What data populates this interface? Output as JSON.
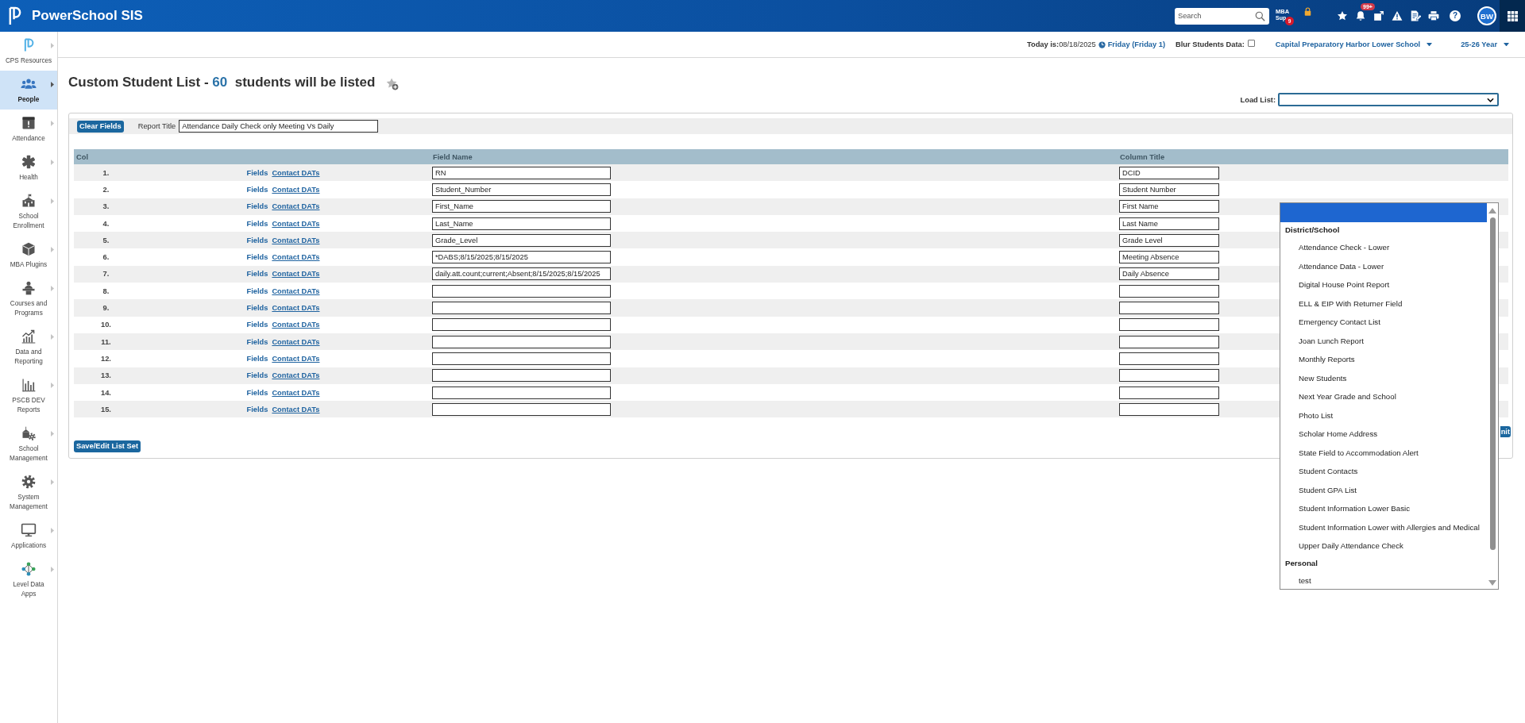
{
  "topbar": {
    "app_name": "PowerSchool SIS",
    "search": {
      "placeholder": "Search"
    },
    "mba": {
      "top": "MBA",
      "bottom": "Sup",
      "badge": "9"
    },
    "bell_badge": "99+",
    "help": "?",
    "avatar": "BW"
  },
  "sidebar": {
    "items": [
      {
        "label": "CPS Resources",
        "selected": false
      },
      {
        "label": "People",
        "selected": true
      },
      {
        "label": "Attendance",
        "selected": false
      },
      {
        "label": "Health",
        "selected": false
      },
      {
        "label": "School Enrollment",
        "selected": false
      },
      {
        "label": "MBA Plugins",
        "selected": false
      },
      {
        "label": "Courses and Programs",
        "selected": false
      },
      {
        "label": "Data and Reporting",
        "selected": false
      },
      {
        "label": "PSCB DEV Reports",
        "selected": false
      },
      {
        "label": "School Management",
        "selected": false
      },
      {
        "label": "System Management",
        "selected": false
      },
      {
        "label": "Applications",
        "selected": false
      },
      {
        "label": "Level Data Apps",
        "selected": false
      }
    ]
  },
  "header": {
    "today_label": "Today is:",
    "date": "08/18/2025",
    "day": "Friday (Friday 1)",
    "blur_label": "Blur Students Data:",
    "blur_checked": false,
    "school": "Capital Preparatory Harbor Lower School",
    "year": "25-26 Year"
  },
  "page": {
    "title": "Custom Student List - ",
    "count": "60",
    "title_end": "students will be listed"
  },
  "load_list": {
    "label": "Load List:",
    "open": true,
    "blank_option_selected": true,
    "groups": [
      {
        "label": "District/School",
        "options": [
          {
            "label": "Attendance Check - Lower",
            "selected": false
          },
          {
            "label": "Attendance Data - Lower",
            "selected": false
          },
          {
            "label": "Digital House Point Report",
            "selected": false
          },
          {
            "label": "ELL & EIP With Returner Field",
            "selected": false
          },
          {
            "label": "Emergency Contact List",
            "selected": false
          },
          {
            "label": "Joan Lunch Report",
            "selected": false
          },
          {
            "label": "Monthly Reports",
            "selected": false
          },
          {
            "label": "New Students",
            "selected": false
          },
          {
            "label": "Next Year Grade and School",
            "selected": false
          },
          {
            "label": "Photo List",
            "selected": false
          },
          {
            "label": "Scholar Home Address",
            "selected": false
          },
          {
            "label": "State Field to Accommodation Alert",
            "selected": false
          },
          {
            "label": "Student Contacts",
            "selected": false
          },
          {
            "label": "Student GPA List",
            "selected": false
          },
          {
            "label": "Student Information Lower Basic",
            "selected": false
          },
          {
            "label": "Student Information Lower with Allergies and Medical",
            "selected": false
          },
          {
            "label": "Upper Daily Attendance Check",
            "selected": false
          }
        ]
      },
      {
        "label": "Personal",
        "options": [
          {
            "label": "test",
            "selected": false
          }
        ]
      }
    ]
  },
  "form": {
    "clear_button": "Clear Fields",
    "report_title_label": "Report Title",
    "report_title": "Attendance Daily Check only Meeting Vs Daily",
    "columns": {
      "col": "Col",
      "field_name": "Field Name",
      "column_title": "Column Title"
    },
    "rows": [
      {
        "number": "1.",
        "fields_link": "Fields",
        "dats_link": "Contact DATs",
        "field_name": "RN",
        "column_title": "DCID"
      },
      {
        "number": "2.",
        "fields_link": "Fields",
        "dats_link": "Contact DATs",
        "field_name": "Student_Number",
        "column_title": "Student Number"
      },
      {
        "number": "3.",
        "fields_link": "Fields",
        "dats_link": "Contact DATs",
        "field_name": "First_Name",
        "column_title": "First Name"
      },
      {
        "number": "4.",
        "fields_link": "Fields",
        "dats_link": "Contact DATs",
        "field_name": "Last_Name",
        "column_title": "Last Name"
      },
      {
        "number": "5.",
        "fields_link": "Fields",
        "dats_link": "Contact DATs",
        "field_name": "Grade_Level",
        "column_title": "Grade Level"
      },
      {
        "number": "6.",
        "fields_link": "Fields",
        "dats_link": "Contact DATs",
        "field_name": "*DABS;8/15/2025;8/15/2025",
        "column_title": "Meeting Absence"
      },
      {
        "number": "7.",
        "fields_link": "Fields",
        "dats_link": "Contact DATs",
        "field_name": "daily.att.count;current;Absent;8/15/2025;8/15/2025",
        "column_title": "Daily Absence"
      },
      {
        "number": "8.",
        "fields_link": "Fields",
        "dats_link": "Contact DATs"
      },
      {
        "number": "9.",
        "fields_link": "Fields",
        "dats_link": "Contact DATs"
      },
      {
        "number": "10.",
        "fields_link": "Fields",
        "dats_link": "Contact DATs"
      },
      {
        "number": "11.",
        "fields_link": "Fields",
        "dats_link": "Contact DATs"
      },
      {
        "number": "12.",
        "fields_link": "Fields",
        "dats_link": "Contact DATs"
      },
      {
        "number": "13.",
        "fields_link": "Fields",
        "dats_link": "Contact DATs"
      },
      {
        "number": "14.",
        "fields_link": "Fields",
        "dats_link": "Contact DATs"
      },
      {
        "number": "15.",
        "fields_link": "Fields",
        "dats_link": "Contact DATs"
      }
    ],
    "submit_button": "nit",
    "save_button": "Save/Edit List Set"
  }
}
